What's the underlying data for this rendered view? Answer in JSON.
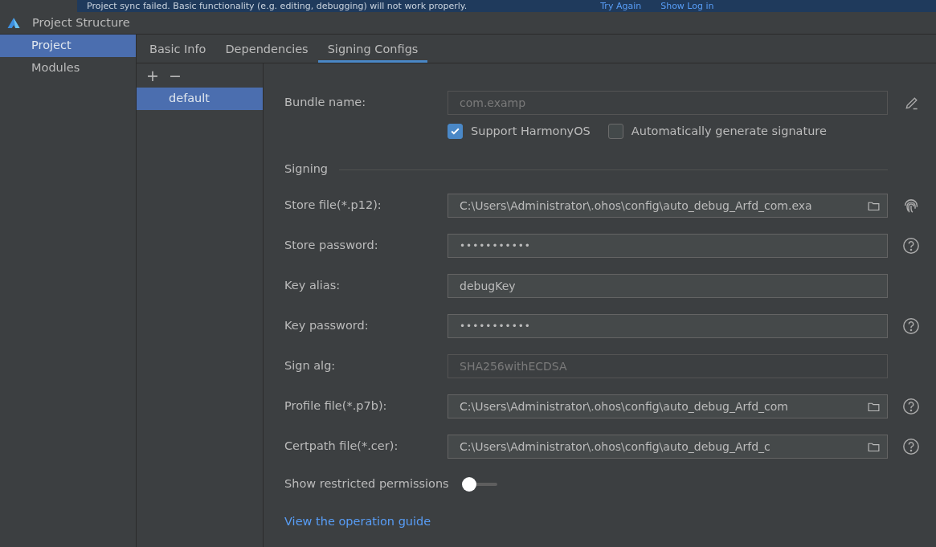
{
  "banner": {
    "message": "Project sync failed. Basic functionality (e.g. editing, debugging) will not work properly.",
    "actions": [
      "Try Again",
      "Show Log in"
    ]
  },
  "window": {
    "title": "Project Structure"
  },
  "sidebar": {
    "items": [
      {
        "label": "Project",
        "selected": true
      },
      {
        "label": "Modules",
        "selected": false
      }
    ]
  },
  "tabs": [
    {
      "label": "Basic Info",
      "selected": false
    },
    {
      "label": "Dependencies",
      "selected": false
    },
    {
      "label": "Signing Configs",
      "selected": true
    }
  ],
  "configs": {
    "toolbar": [
      "+",
      "−"
    ],
    "items": [
      {
        "label": "default",
        "selected": true
      }
    ]
  },
  "bundle": {
    "label": "Bundle name:",
    "value": "com.examp",
    "disabled": true
  },
  "options": [
    {
      "label": "Support HarmonyOS",
      "checked": true
    },
    {
      "label": "Automatically generate signature",
      "checked": false
    }
  ],
  "signing": {
    "title": "Signing",
    "fields": [
      {
        "kind": "path",
        "label": "Store file(*.p12):",
        "value": "C:\\Users\\Administrator\\.ohos\\config\\auto_debug_Arfd_com.exa",
        "side": {
          "kind": "fingerprint"
        }
      },
      {
        "kind": "password",
        "label": "Store password:",
        "value": "•••••••••••",
        "side": {
          "kind": "help"
        }
      },
      {
        "kind": "text",
        "label": "Key alias:",
        "value": "debugKey"
      },
      {
        "kind": "password",
        "label": "Key password:",
        "value": "•••••••••••",
        "side": {
          "kind": "help"
        }
      },
      {
        "kind": "text",
        "label": "Sign alg:",
        "value": "SHA256withECDSA",
        "disabled": true
      },
      {
        "kind": "path",
        "label": "Profile file(*.p7b):",
        "value": "C:\\Users\\Administrator\\.ohos\\config\\auto_debug_Arfd_com",
        "side": {
          "kind": "help"
        }
      },
      {
        "kind": "path",
        "label": "Certpath file(*.cer):",
        "value": "C:\\Users\\Administrator\\.ohos\\config\\auto_debug_Arfd_c",
        "side": {
          "kind": "help"
        }
      }
    ]
  },
  "restricted": {
    "label": "Show restricted permissions",
    "on": false
  },
  "guide_link": "View the operation guide"
}
